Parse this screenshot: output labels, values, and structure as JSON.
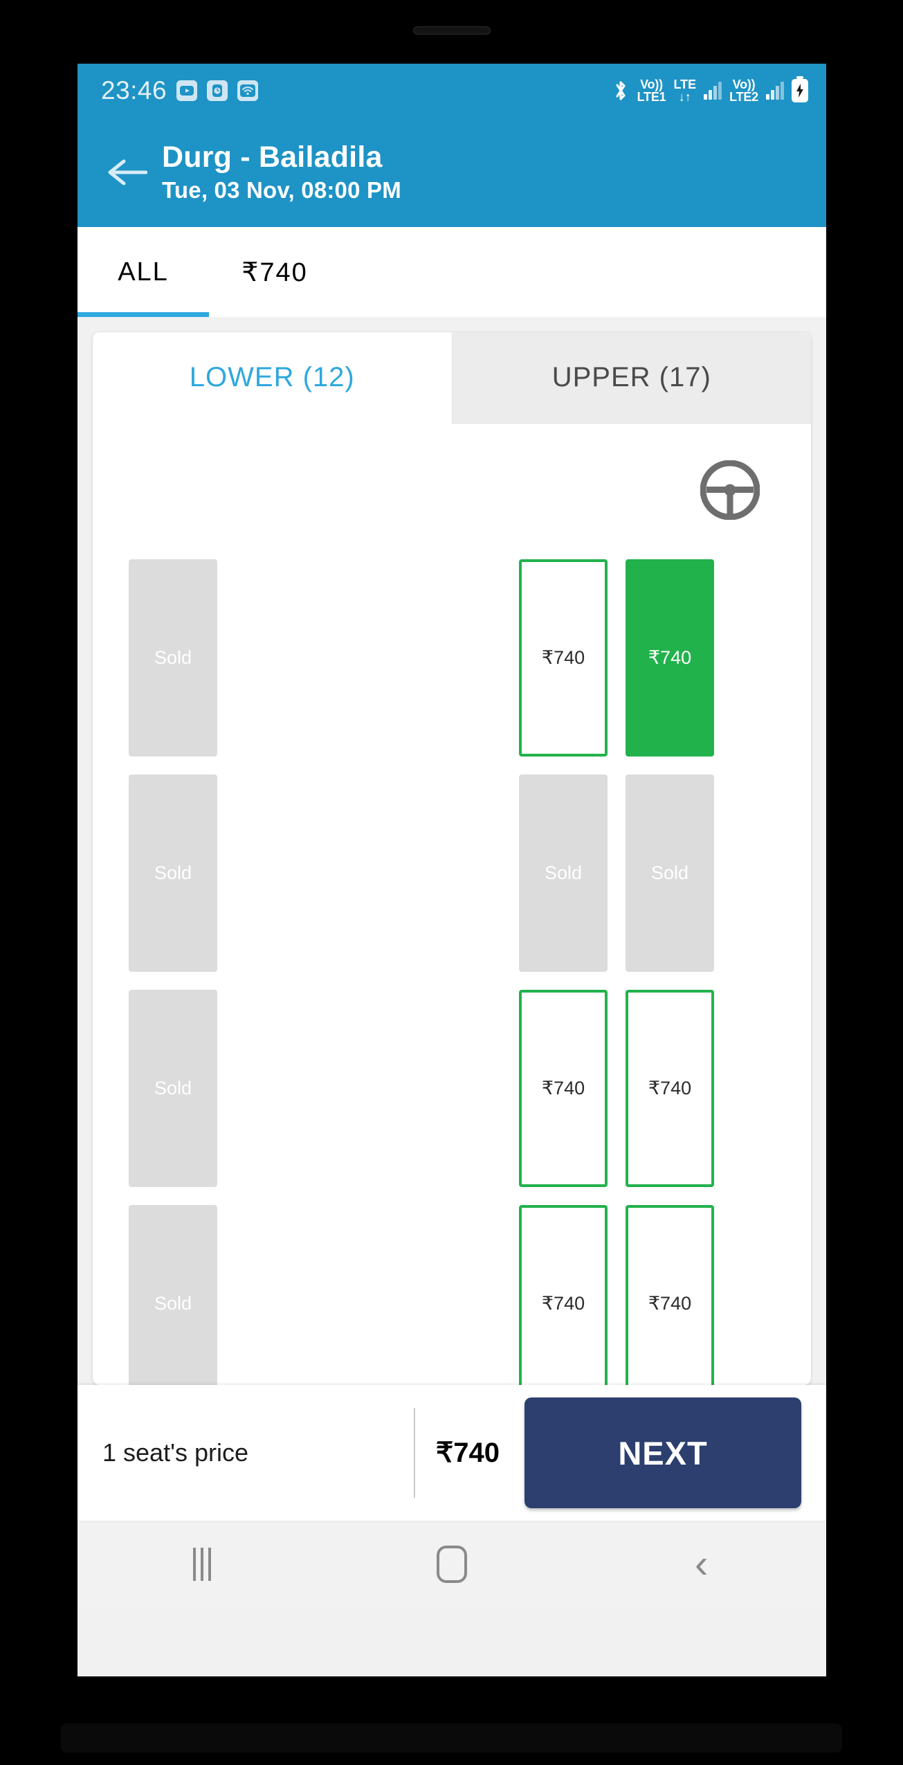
{
  "status_bar": {
    "time": "23:46",
    "left_icons": [
      {
        "name": "youtube-icon",
        "glyph": "▶"
      },
      {
        "name": "clock-icon",
        "glyph": "◔"
      },
      {
        "name": "wifi-icon",
        "glyph": "▲"
      }
    ],
    "bluetooth_label": "bluetooth-icon",
    "sim1_volte_top": "Vo))",
    "sim1_volte_bottom": "LTE1",
    "lte_label": "LTE",
    "data_arrows": "↓↑",
    "sim2_volte_top": "Vo))",
    "sim2_volte_bottom": "LTE2",
    "battery_glyph": "⚡"
  },
  "app_bar": {
    "back_icon": "back-arrow-icon",
    "title": "Durg - Bailadila",
    "subtitle": "Tue, 03 Nov,  08:00 PM"
  },
  "price_tabs": [
    {
      "label": "ALL",
      "active": true
    },
    {
      "label": "₹740",
      "active": false
    }
  ],
  "deck_tabs": [
    {
      "label": "LOWER (12)",
      "active": true
    },
    {
      "label": "UPPER (17)",
      "active": false
    }
  ],
  "seat_map": {
    "driver_icon": "steering-wheel-icon",
    "sold_label": "Sold",
    "rows": [
      {
        "left": [
          {
            "state": "sold",
            "label": "Sold"
          }
        ],
        "right": [
          {
            "state": "free",
            "label": "₹740"
          },
          {
            "state": "selected",
            "label": "₹740"
          }
        ]
      },
      {
        "left": [
          {
            "state": "sold",
            "label": "Sold"
          }
        ],
        "right": [
          {
            "state": "sold",
            "label": "Sold"
          },
          {
            "state": "sold",
            "label": "Sold"
          }
        ]
      },
      {
        "left": [
          {
            "state": "sold",
            "label": "Sold"
          }
        ],
        "right": [
          {
            "state": "free",
            "label": "₹740"
          },
          {
            "state": "free",
            "label": "₹740"
          }
        ]
      },
      {
        "left": [
          {
            "state": "sold",
            "label": "Sold"
          }
        ],
        "right": [
          {
            "state": "free",
            "label": "₹740"
          },
          {
            "state": "free",
            "label": "₹740"
          }
        ]
      }
    ]
  },
  "bottom_bar": {
    "seat_count_label": "1 seat's price",
    "fare_total": "₹740",
    "next_label": "NEXT"
  },
  "nav_bar": {
    "recents_label": "recents-button",
    "home_label": "home-button",
    "back_label": "back-button"
  },
  "colors": {
    "brand_blue": "#1e93c5",
    "tab_accent": "#2ea8dd",
    "seat_green": "#22b24c",
    "sold_gray": "#dcdcdc",
    "next_navy": "#2c3f6e"
  }
}
